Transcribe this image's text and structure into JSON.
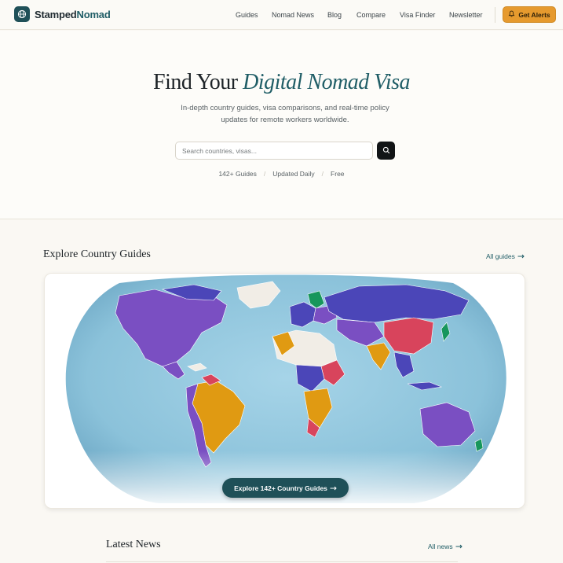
{
  "nav": {
    "brand_part1": "Stamped",
    "brand_part2": "Nomad",
    "links": [
      "Guides",
      "Nomad News",
      "Blog",
      "Compare",
      "Visa Finder",
      "Newsletter"
    ],
    "cta_label": "Get Alerts"
  },
  "hero": {
    "title_plain": "Find Your",
    "title_accent": "Digital Nomad Visa",
    "subtitle": "In-depth country guides, visa comparisons, and real-time policy updates for remote workers worldwide.",
    "search_placeholder": "Search countries, visas...",
    "stats": [
      "142+ Guides",
      "Updated Daily",
      "Free"
    ]
  },
  "explore": {
    "title": "Explore Country Guides",
    "all_link": "All guides",
    "button_label": "Explore 142+ Country Guides"
  },
  "news": {
    "title": "Latest News",
    "all_link": "All news"
  },
  "colors": {
    "brand": "#1f5058",
    "accent": "#e69a2e",
    "ocean": "#8cc3db",
    "region_purple": "#7a4fc2",
    "region_orange": "#e09a12",
    "region_red": "#d8445c",
    "region_indigo": "#4b46b8",
    "region_green": "#17965c",
    "region_unlisted": "#f1ede6"
  }
}
